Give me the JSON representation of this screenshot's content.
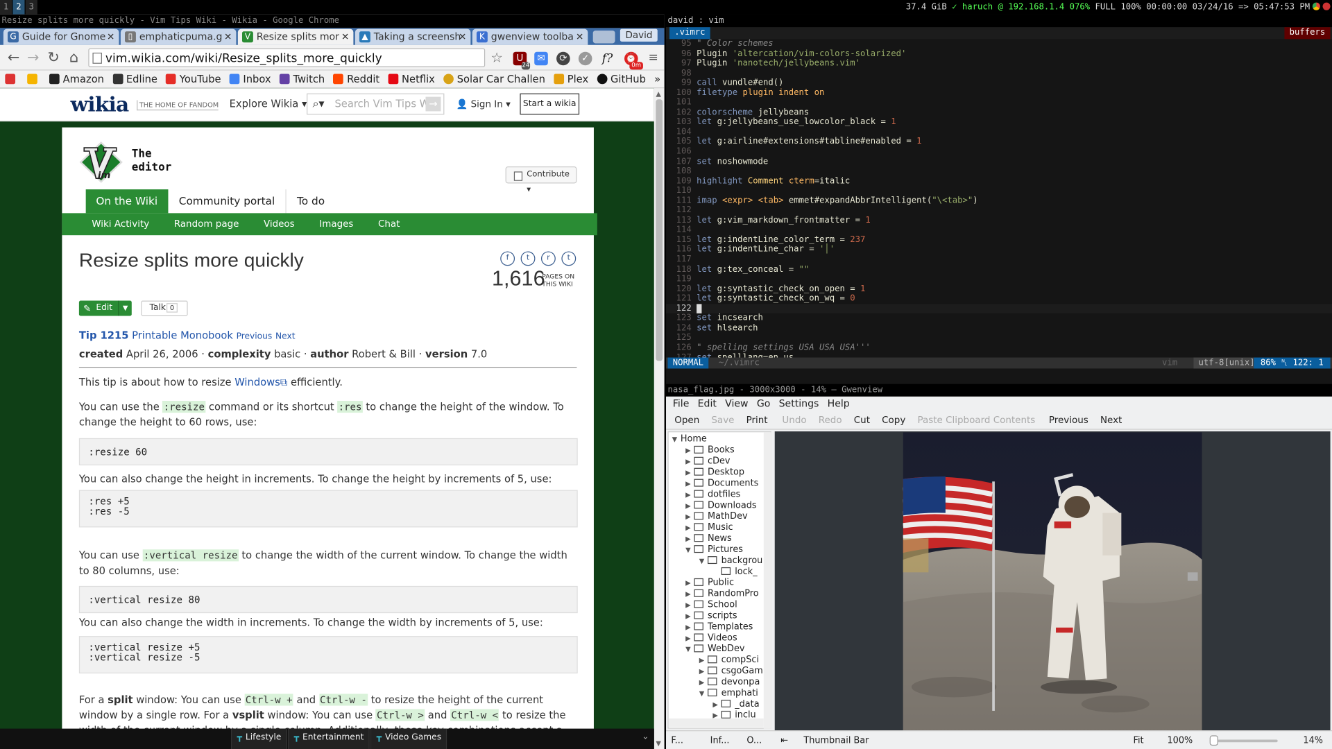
{
  "topbar": {
    "workspaces": [
      "1",
      "2",
      "3"
    ],
    "active_workspace": "2",
    "status_pre": "37.4 GiB ",
    "status_wifi": "haruch @ 192.168.1.4 076%",
    "status_post": " FULL 100% 00:00:00 03/24/16 => 05:47:53 PM"
  },
  "chrome": {
    "window_title": "Resize splits more quickly - Vim Tips Wiki - Wikia - Google Chrome",
    "tabs": [
      {
        "label": "Guide for Gnome",
        "color": "#3b6aa5",
        "glyph": "G"
      },
      {
        "label": "emphaticpuma.g",
        "color": "#666",
        "glyph": "▯"
      },
      {
        "label": "Resize splits mor",
        "color": "#2a8c34",
        "glyph": "V"
      },
      {
        "label": "Taking a screensh",
        "color": "#2a7ab9",
        "glyph": "▲"
      },
      {
        "label": "gwenview toolba",
        "color": "#3a6fd1",
        "glyph": "K"
      }
    ],
    "profile": "David",
    "url": "vim.wikia.com/wiki/Resize_splits_more_quickly",
    "bookmarks": [
      {
        "label": "Amazon",
        "color": "#222"
      },
      {
        "label": "Edline",
        "color": "#333"
      },
      {
        "label": "YouTube",
        "color": "#e52d27"
      },
      {
        "label": "Inbox",
        "color": "#4285f4"
      },
      {
        "label": "Twitch",
        "color": "#6441a5"
      },
      {
        "label": "Reddit",
        "color": "#ff4500"
      },
      {
        "label": "Netflix",
        "color": "#e50914"
      },
      {
        "label": "Solar Car Challen",
        "color": "#d8a317"
      },
      {
        "label": "Plex",
        "color": "#e5a00d"
      },
      {
        "label": "GitHub",
        "color": "#111"
      }
    ],
    "ext_badges": {
      "ublock": "24",
      "timer": "0m"
    }
  },
  "wikia": {
    "logo": "wikia",
    "tagline": "THE HOME OF FANDOM",
    "explore": "Explore Wikia ▾",
    "search_placeholder": "Search Vim Tips Wiki",
    "sign_in": "Sign In ▾",
    "start": "Start a wikia",
    "site_name_line1": "The",
    "site_name_line2": "editor",
    "contribute": "Contribute ▾",
    "tabs": [
      "On the Wiki",
      "Community portal",
      "To do"
    ],
    "subnav": [
      "Wiki Activity",
      "Random page",
      "Videos",
      "Images",
      "Chat"
    ],
    "page_title": "Resize splits more quickly",
    "page_count": "1,616",
    "page_count_label1": "PAGES ON",
    "page_count_label2": "THIS WIKI",
    "edit": "Edit",
    "talk": "Talk",
    "talk_count": "0",
    "tip": "Tip 1215",
    "printable": "Printable Monobook",
    "prev": "Previous",
    "next": "Next",
    "meta": {
      "created_label": "created",
      "created": "April 26, 2006",
      "complexity_label": "complexity",
      "complexity": "basic",
      "author_label": "author",
      "author": "Robert & Bill",
      "version_label": "version",
      "version": "7.0"
    },
    "p1a": "This tip is about how to resize ",
    "p1link": "Windows",
    "p1b": " efficiently.",
    "p2a": "You can use the ",
    "p2code1": ":resize",
    "p2b": " command or its shortcut ",
    "p2code2": ":res",
    "p2c": " to change the height of the window. To change the height to 60 rows, use:",
    "pre1": ":resize 60",
    "p3": "You can also change the height in increments. To change the height by increments of 5, use:",
    "pre2": ":res +5\n:res -5",
    "p4a": "You can use ",
    "p4code": ":vertical resize",
    "p4b": " to change the width of the current window. To change the width to 80 columns, use:",
    "pre3": ":vertical resize 80",
    "p5": "You can also change the width in increments. To change the width by increments of 5, use:",
    "pre4": ":vertical resize +5\n:vertical resize -5",
    "p6a": "For a ",
    "p6b1": "split",
    "p6c": " window: You can use ",
    "p6k1": "Ctrl-w +",
    "p6d": " and ",
    "p6k2": "Ctrl-w -",
    "p6e": " to resize the height of the current window by a single row. For a ",
    "p6b2": "vsplit",
    "p6f": " window: You can use ",
    "p6k3": "Ctrl-w >",
    "p6g": " and ",
    "p6k4": "Ctrl-w <",
    "p6h": " to resize the width of the current window by a single column. Additionally, these key combinations accept a count prefix so that you can change the window size in",
    "bottombar": [
      "Lifestyle",
      "Entertainment",
      "Video Games"
    ]
  },
  "vim": {
    "title": "david : vim",
    "tab": ".vimrc",
    "buffers": "buffers",
    "mode": "NORMAL",
    "file": "~/.vimrc",
    "filetype": "vim",
    "encoding": "utf-8[unix]",
    "position": "86% ␤ 122:  1",
    "lines": [
      {
        "n": "95",
        "h": "<span class='cm'>\" Color schemes</span>"
      },
      {
        "n": "96",
        "h": "Plugin <span class='st'>'altercation/vim-colors-solarized'</span>"
      },
      {
        "n": "97",
        "h": "Plugin <span class='st'>'nanotech/jellybeans.vim'</span>"
      },
      {
        "n": "98",
        "h": ""
      },
      {
        "n": "99",
        "h": "<span class='kw'>call</span> vundle#end()"
      },
      {
        "n": "100",
        "h": "<span class='kw'>filetype</span> <span class='ty'>plugin indent on</span>"
      },
      {
        "n": "101",
        "h": ""
      },
      {
        "n": "102",
        "h": "<span class='kw'>colorscheme</span> jellybeans"
      },
      {
        "n": "103",
        "h": "<span class='kw'>let</span> g:jellybeans_use_lowcolor_black = <span class='nm'>1</span>"
      },
      {
        "n": "104",
        "h": ""
      },
      {
        "n": "105",
        "h": "<span class='kw'>let</span> g:airline#extensions#tabline#enabled = <span class='nm'>1</span>"
      },
      {
        "n": "106",
        "h": ""
      },
      {
        "n": "107",
        "h": "<span class='kw'>set</span> noshowmode"
      },
      {
        "n": "108",
        "h": ""
      },
      {
        "n": "109",
        "h": "<span class='kw'>highlight</span> <span class='fn'>Comment</span> <span class='ty'>cterm</span>=italic"
      },
      {
        "n": "110",
        "h": ""
      },
      {
        "n": "111",
        "h": "<span class='kw'>imap</span> <span class='ty'>&lt;expr&gt;</span> <span class='ty'>&lt;tab&gt;</span> emmet#expandAbbrIntelligent(<span class='st'>\"\\&lt;tab&gt;\"</span>)"
      },
      {
        "n": "112",
        "h": ""
      },
      {
        "n": "113",
        "h": "<span class='kw'>let</span> g:vim_markdown_frontmatter = <span class='nm'>1</span>"
      },
      {
        "n": "114",
        "h": ""
      },
      {
        "n": "115",
        "h": "<span class='kw'>let</span> g:indentLine_color_term = <span class='nm'>237</span>"
      },
      {
        "n": "116",
        "h": "<span class='kw'>let</span> g:indentLine_char = <span class='st'>'│'</span>"
      },
      {
        "n": "117",
        "h": ""
      },
      {
        "n": "118",
        "h": "<span class='kw'>let</span> g:tex_conceal = <span class='st'>\"\"</span>"
      },
      {
        "n": "119",
        "h": ""
      },
      {
        "n": "120",
        "h": "<span class='kw'>let</span> g:syntastic_check_on_open = <span class='nm'>1</span>"
      },
      {
        "n": "121",
        "h": "<span class='kw'>let</span> g:syntastic_check_on_wq = <span class='nm'>0</span>"
      },
      {
        "n": "122",
        "h": "<span style='background:#ddd;color:#000'> </span>",
        "cur": true
      },
      {
        "n": "123",
        "h": "<span class='kw'>set</span> incsearch"
      },
      {
        "n": "124",
        "h": "<span class='kw'>set</span> hlsearch"
      },
      {
        "n": "125",
        "h": ""
      },
      {
        "n": "126",
        "h": "<span class='cm'>\" spelling settings USA USA USA'''</span>"
      },
      {
        "n": "127",
        "h": "<span class='kw'>set</span> spelllang=en_us"
      }
    ]
  },
  "gwenview": {
    "title": "nasa_flag.jpg - 3000x3000 - 14% — Gwenview",
    "menu": [
      "File",
      "Edit",
      "View",
      "Go",
      "Settings",
      "Help"
    ],
    "toolbar": [
      {
        "label": "Open",
        "dis": false
      },
      {
        "label": "Save",
        "dis": true
      },
      {
        "label": "Print",
        "dis": false
      },
      {
        "label": "Undo",
        "dis": true
      },
      {
        "label": "Redo",
        "dis": true
      },
      {
        "label": "Cut",
        "dis": false
      },
      {
        "label": "Copy",
        "dis": false
      },
      {
        "label": "Paste Clipboard Contents",
        "dis": true
      },
      {
        "label": "Previous",
        "dis": false
      },
      {
        "label": "Next",
        "dis": false
      }
    ],
    "tree": [
      {
        "label": "Home",
        "d": 0,
        "ar": "▼",
        "f": false
      },
      {
        "label": "Books",
        "d": 1,
        "ar": "▶",
        "f": true
      },
      {
        "label": "cDev",
        "d": 1,
        "ar": "▶",
        "f": true
      },
      {
        "label": "Desktop",
        "d": 1,
        "ar": "▶",
        "f": true
      },
      {
        "label": "Documents",
        "d": 1,
        "ar": "▶",
        "f": true
      },
      {
        "label": "dotfiles",
        "d": 1,
        "ar": "▶",
        "f": true
      },
      {
        "label": "Downloads",
        "d": 1,
        "ar": "▶",
        "f": true
      },
      {
        "label": "MathDev",
        "d": 1,
        "ar": "▶",
        "f": true
      },
      {
        "label": "Music",
        "d": 1,
        "ar": "▶",
        "f": true
      },
      {
        "label": "News",
        "d": 1,
        "ar": "▶",
        "f": true
      },
      {
        "label": "Pictures",
        "d": 1,
        "ar": "▼",
        "f": true
      },
      {
        "label": "backgrou",
        "d": 2,
        "ar": "▼",
        "f": true
      },
      {
        "label": "lock_",
        "d": 3,
        "ar": "",
        "f": true
      },
      {
        "label": "Public",
        "d": 1,
        "ar": "▶",
        "f": true
      },
      {
        "label": "RandomPro",
        "d": 1,
        "ar": "▶",
        "f": true
      },
      {
        "label": "School",
        "d": 1,
        "ar": "▶",
        "f": true
      },
      {
        "label": "scripts",
        "d": 1,
        "ar": "▶",
        "f": true
      },
      {
        "label": "Templates",
        "d": 1,
        "ar": "▶",
        "f": true
      },
      {
        "label": "Videos",
        "d": 1,
        "ar": "▶",
        "f": true
      },
      {
        "label": "WebDev",
        "d": 1,
        "ar": "▼",
        "f": true
      },
      {
        "label": "compSci",
        "d": 2,
        "ar": "▶",
        "f": true
      },
      {
        "label": "csgoGam",
        "d": 2,
        "ar": "▶",
        "f": true
      },
      {
        "label": "devonpa",
        "d": 2,
        "ar": "▶",
        "f": true
      },
      {
        "label": "emphati",
        "d": 2,
        "ar": "▼",
        "f": true
      },
      {
        "label": "_data",
        "d": 3,
        "ar": "▶",
        "f": true
      },
      {
        "label": "inclu",
        "d": 3,
        "ar": "▶",
        "f": true
      }
    ],
    "sidebar_tabs": [
      "F...",
      "Inf...",
      "O..."
    ],
    "thumbnail_bar": "Thumbnail Bar",
    "fit": "Fit",
    "zoom_100": "100%",
    "zoom": "14%"
  }
}
